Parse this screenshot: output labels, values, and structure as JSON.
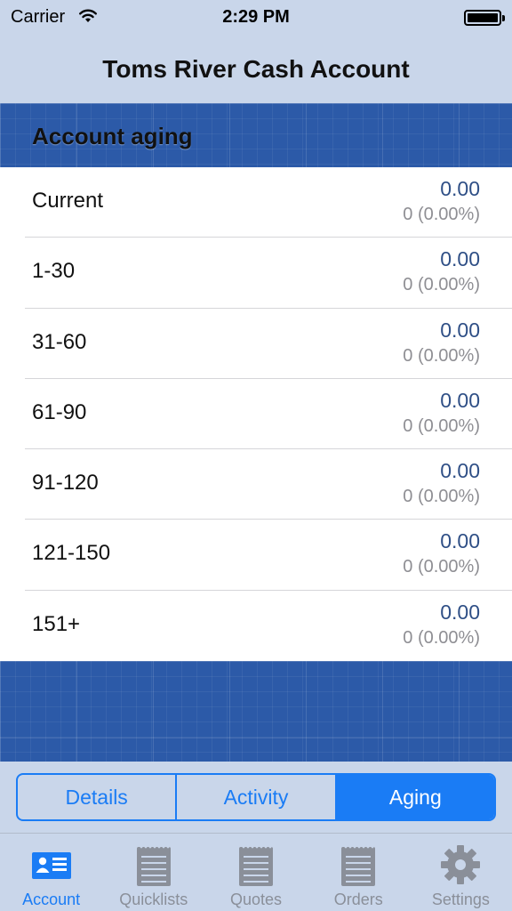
{
  "status_bar": {
    "carrier": "Carrier",
    "time": "2:29 PM"
  },
  "nav": {
    "title": "Toms River Cash Account"
  },
  "section": {
    "title": "Account aging"
  },
  "aging_rows": [
    {
      "label": "Current",
      "amount": "0.00",
      "detail": "0 (0.00%)"
    },
    {
      "label": "1-30",
      "amount": "0.00",
      "detail": "0 (0.00%)"
    },
    {
      "label": "31-60",
      "amount": "0.00",
      "detail": "0 (0.00%)"
    },
    {
      "label": "61-90",
      "amount": "0.00",
      "detail": "0 (0.00%)"
    },
    {
      "label": "91-120",
      "amount": "0.00",
      "detail": "0 (0.00%)"
    },
    {
      "label": "121-150",
      "amount": "0.00",
      "detail": "0 (0.00%)"
    },
    {
      "label": "151+",
      "amount": "0.00",
      "detail": "0 (0.00%)"
    }
  ],
  "segments": {
    "items": [
      "Details",
      "Activity",
      "Aging"
    ],
    "selected": "Aging"
  },
  "tabs": [
    {
      "label": "Account",
      "icon": "account-card-icon",
      "active": true
    },
    {
      "label": "Quicklists",
      "icon": "notepad-icon",
      "active": false
    },
    {
      "label": "Quotes",
      "icon": "notepad-icon",
      "active": false
    },
    {
      "label": "Orders",
      "icon": "notepad-icon",
      "active": false
    },
    {
      "label": "Settings",
      "icon": "gear-icon",
      "active": false
    }
  ],
  "colors": {
    "accent": "#1a7cf5",
    "amount_text": "#2f4f86",
    "bar_background": "#c9d6ea",
    "blueprint": "#2c5aa8",
    "tab_inactive": "#8a8f99"
  }
}
